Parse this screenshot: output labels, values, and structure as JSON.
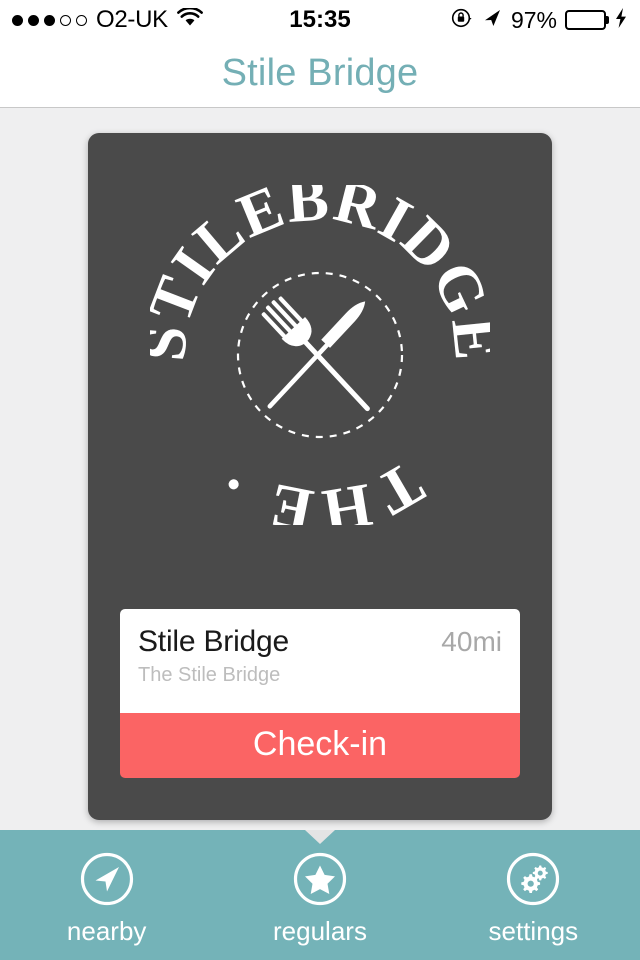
{
  "status_bar": {
    "carrier": "O2-UK",
    "signal_bars_filled": 3,
    "signal_bars_total": 5,
    "wifi_icon": "wifi-icon",
    "time": "15:35",
    "rotation_lock_icon": "rotation-lock-icon",
    "location_icon": "location-arrow-icon",
    "battery_percent": "97%",
    "battery_level": 97,
    "battery_color": "#4cd964",
    "charging_icon": "lightning-bolt-icon"
  },
  "header": {
    "title": "Stile Bridge",
    "title_color": "#74afb5"
  },
  "card": {
    "background_color": "#4a4a4a",
    "logo": {
      "icon_name": "stile-bridge-crest-logo",
      "outer_text_top": "STILEBRIDGE",
      "outer_text_bottom": "THE",
      "separator_glyph": "·",
      "inner_icon": "crossed-knife-fork-icon"
    },
    "venue": {
      "name": "Stile Bridge",
      "distance": "40mi",
      "subtitle": "The Stile Bridge"
    },
    "checkin_label": "Check-in",
    "checkin_color": "#fb6464"
  },
  "tab_bar": {
    "background_color": "#74b3b8",
    "active_index": 1,
    "items": [
      {
        "label": "nearby",
        "icon": "compass-arrow-icon"
      },
      {
        "label": "regulars",
        "icon": "star-icon"
      },
      {
        "label": "settings",
        "icon": "gears-icon"
      }
    ]
  }
}
